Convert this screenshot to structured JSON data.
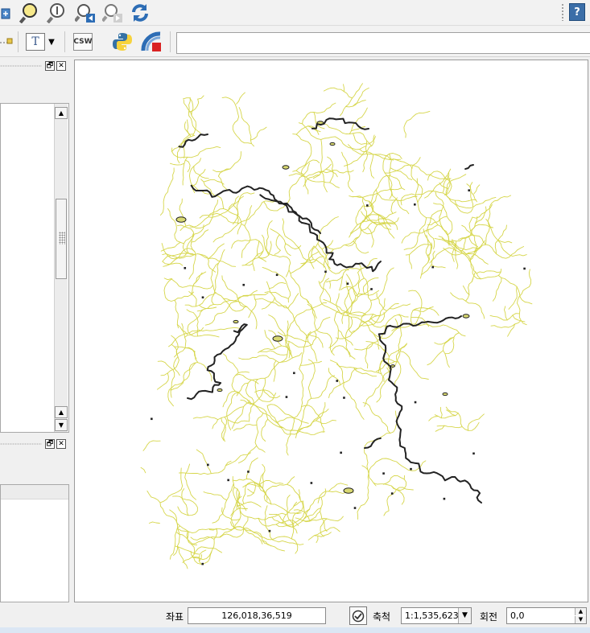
{
  "toolbar": {
    "icons": [
      "zoom-to-layer-icon",
      "zoom-to-selection-icon",
      "zoom-native-icon",
      "zoom-last-icon",
      "zoom-next-icon",
      "refresh-icon",
      "help-icon"
    ],
    "help_label": "?",
    "csw_label": "CSW",
    "text_tool_label": "T",
    "text_tool_arrow": "▼",
    "python_icon": "python-console-icon",
    "georef_icon": "georeferencer-icon"
  },
  "panels": {
    "restore_glyph": "🗗",
    "close_glyph": "✕",
    "scroll_up": "▲",
    "scroll_down": "▼"
  },
  "statusbar": {
    "coord_label": "좌표",
    "coord_value": "126,018,36,519",
    "scale_label": "축척",
    "scale_value": "1:1,535,623",
    "scale_arrow": "▼",
    "rotation_label": "회전",
    "rotation_value": "0,0",
    "spin_up": "▲",
    "spin_down": "▼",
    "render_icon": "render-toggle-icon"
  },
  "colors": {
    "river_minor": "#d6d64a",
    "river_major": "#222222",
    "lake_fill": "#d8d870",
    "accent_blue": "#2d6db5"
  }
}
